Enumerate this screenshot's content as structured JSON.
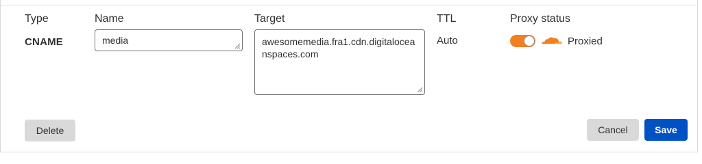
{
  "headers": {
    "type": "Type",
    "name": "Name",
    "target": "Target",
    "ttl": "TTL",
    "proxy_status": "Proxy status"
  },
  "record": {
    "type": "CNAME",
    "name": "media",
    "target": "awesomemedia.fra1.cdn.digitaloceanspaces.com",
    "ttl": "Auto",
    "proxy_enabled": true,
    "proxy_label": "Proxied"
  },
  "actions": {
    "delete_label": "Delete",
    "cancel_label": "Cancel",
    "save_label": "Save"
  },
  "colors": {
    "accent_orange": "#f38020",
    "primary_blue": "#0051c3",
    "button_grey": "#d9d9d9",
    "text": "#313131"
  },
  "icons": {
    "proxy_status": "cloud-icon",
    "resize": "resize-grip-icon"
  }
}
